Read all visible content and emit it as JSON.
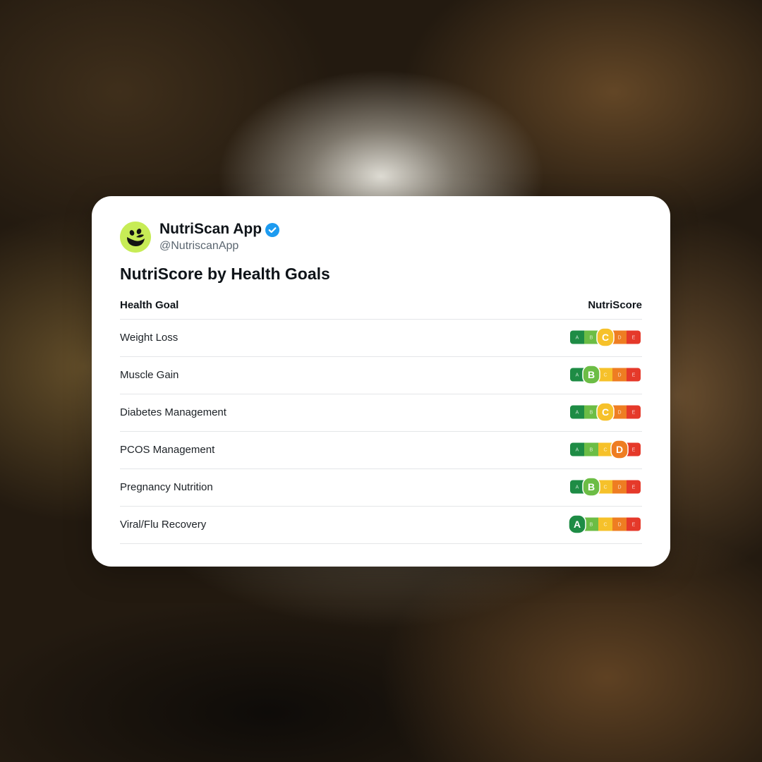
{
  "colors": {
    "A": "#1e8c45",
    "B": "#6cbd45",
    "C": "#f6c12a",
    "D": "#ee7d22",
    "E": "#e5392a",
    "brand": "#c7ec56",
    "verified": "#1d9bf0"
  },
  "profile": {
    "name": "NutriScan App",
    "handle": "@NutriscanApp",
    "verified": true,
    "avatar_icon": "smiling-leaf-logo-icon"
  },
  "title": "NutriScore by Health Goals",
  "table": {
    "headers": [
      "Health Goal",
      "NutriScore"
    ],
    "grade_letters": [
      "A",
      "B",
      "C",
      "D",
      "E"
    ],
    "rows": [
      {
        "goal": "Weight Loss",
        "score": "C"
      },
      {
        "goal": "Muscle Gain",
        "score": "B"
      },
      {
        "goal": "Diabetes Management",
        "score": "C"
      },
      {
        "goal": "PCOS Management",
        "score": "D"
      },
      {
        "goal": "Pregnancy Nutrition",
        "score": "B"
      },
      {
        "goal": "Viral/Flu Recovery",
        "score": "A"
      }
    ]
  }
}
